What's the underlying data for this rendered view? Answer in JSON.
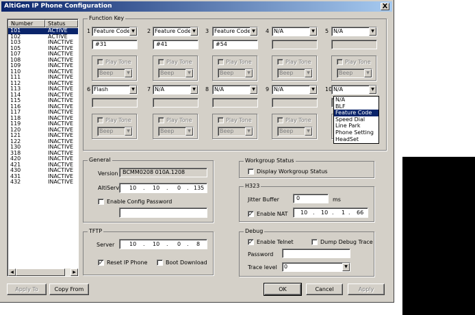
{
  "window": {
    "title": "AltiGen IP Phone Configuration",
    "close_label": "X"
  },
  "list": {
    "columns": [
      "Number",
      "Status"
    ],
    "rows": [
      [
        "101",
        "ACTIVE"
      ],
      [
        "102",
        "ACTIVE"
      ],
      [
        "103",
        "INACTIVE"
      ],
      [
        "105",
        "INACTIVE"
      ],
      [
        "107",
        "INACTIVE"
      ],
      [
        "108",
        "INACTIVE"
      ],
      [
        "109",
        "INACTIVE"
      ],
      [
        "110",
        "INACTIVE"
      ],
      [
        "111",
        "INACTIVE"
      ],
      [
        "112",
        "INACTIVE"
      ],
      [
        "113",
        "INACTIVE"
      ],
      [
        "114",
        "INACTIVE"
      ],
      [
        "115",
        "INACTIVE"
      ],
      [
        "116",
        "INACTIVE"
      ],
      [
        "117",
        "INACTIVE"
      ],
      [
        "118",
        "INACTIVE"
      ],
      [
        "119",
        "INACTIVE"
      ],
      [
        "120",
        "INACTIVE"
      ],
      [
        "121",
        "INACTIVE"
      ],
      [
        "122",
        "INACTIVE"
      ],
      [
        "130",
        "INACTIVE"
      ],
      [
        "318",
        "INACTIVE"
      ],
      [
        "420",
        "INACTIVE"
      ],
      [
        "421",
        "INACTIVE"
      ],
      [
        "430",
        "INACTIVE"
      ],
      [
        "431",
        "INACTIVE"
      ],
      [
        "432",
        "INACTIVE"
      ]
    ],
    "selected_row": 0
  },
  "function_key": {
    "title": "Function Key",
    "keys": [
      {
        "num": "1",
        "type": "Feature Code",
        "value": "#31",
        "enabled": true
      },
      {
        "num": "2",
        "type": "Feature Code",
        "value": "#41",
        "enabled": true
      },
      {
        "num": "3",
        "type": "Feature Code",
        "value": "#54",
        "enabled": true
      },
      {
        "num": "4",
        "type": "N/A",
        "value": "",
        "enabled": false
      },
      {
        "num": "5",
        "type": "N/A",
        "value": "",
        "enabled": false
      },
      {
        "num": "6",
        "type": "Flash",
        "value": "",
        "enabled": false
      },
      {
        "num": "7",
        "type": "N/A",
        "value": "",
        "enabled": false
      },
      {
        "num": "8",
        "type": "N/A",
        "value": "",
        "enabled": false
      },
      {
        "num": "9",
        "type": "N/A",
        "value": "",
        "enabled": false
      },
      {
        "num": "10",
        "type": "N/A",
        "value": "",
        "enabled": false
      }
    ],
    "play_tone_label": "Play Tone",
    "beep_label": "Beep",
    "dropdown_options": [
      "N/A",
      "BLF",
      "Feature Code",
      "Speed Dial",
      "Line Park",
      "Phone Setting",
      "HeadSet"
    ],
    "dropdown_selected": 2
  },
  "general": {
    "title": "General",
    "version_label": "Version",
    "version_value": "BCMM0208 010A.1208",
    "altiserv_label": "AltiServ",
    "altiserv_ip": [
      "10",
      "10",
      "0",
      "135"
    ],
    "config_password_label": "Enable Config Password",
    "config_password_checked": false,
    "config_password_value": ""
  },
  "tftp": {
    "title": "TFTP",
    "server_label": "Server",
    "server_ip": [
      "10",
      "10",
      "0",
      "8"
    ],
    "reset_label": "Reset IP Phone",
    "reset_checked": true,
    "boot_label": "Boot Download",
    "boot_checked": false
  },
  "workgroup": {
    "title": "Workgroup Status",
    "display_label": "Display Workgroup Status",
    "display_checked": false
  },
  "h323": {
    "title": "H323",
    "jitter_label": "Jitter Buffer",
    "jitter_value": "0",
    "jitter_unit": "ms",
    "nat_label": "Enable NAT",
    "nat_checked": true,
    "nat_ip": [
      "10",
      "10",
      "1",
      "66"
    ]
  },
  "debug": {
    "title": "Debug",
    "telnet_label": "Enable Telnet",
    "telnet_checked": true,
    "dump_label": "Dump Debug Trace",
    "dump_checked": false,
    "password_label": "Password",
    "password_value": "",
    "trace_label": "Trace level",
    "trace_value": "0"
  },
  "buttons": {
    "apply_to": "Apply To",
    "copy_from": "Copy From",
    "ok": "OK",
    "cancel": "Cancel",
    "apply": "Apply"
  }
}
